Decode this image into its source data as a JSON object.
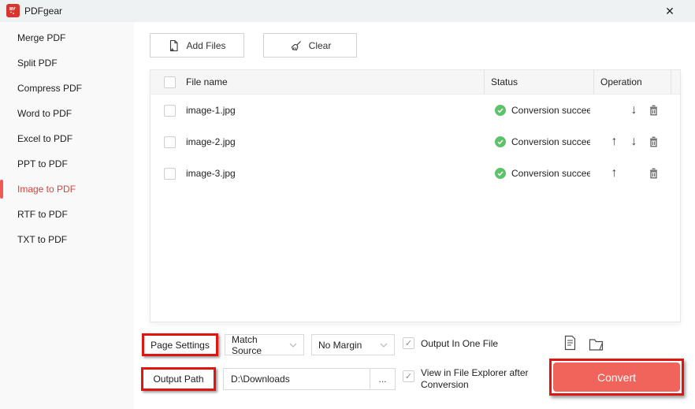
{
  "window": {
    "app_title": "PDFgear",
    "close_glyph": "✕"
  },
  "sidebar": {
    "items": [
      {
        "label": "Merge PDF"
      },
      {
        "label": "Split PDF"
      },
      {
        "label": "Compress PDF"
      },
      {
        "label": "Word to PDF"
      },
      {
        "label": "Excel to PDF"
      },
      {
        "label": "PPT to PDF"
      },
      {
        "label": "Image to PDF",
        "active": true
      },
      {
        "label": "RTF to PDF"
      },
      {
        "label": "TXT to PDF"
      }
    ]
  },
  "toolbar": {
    "add_files_label": "Add Files",
    "clear_label": "Clear"
  },
  "file_table": {
    "headers": {
      "file_name": "File name",
      "status": "Status",
      "operation": "Operation"
    },
    "rows": [
      {
        "file_name": "image-1.jpg",
        "status": "Conversion succeeded",
        "operations": [
          "move-down",
          "delete"
        ]
      },
      {
        "file_name": "image-2.jpg",
        "status": "Conversion succeeded",
        "operations": [
          "move-up",
          "move-down",
          "delete"
        ]
      },
      {
        "file_name": "image-3.jpg",
        "status": "Conversion succeeded",
        "operations": [
          "move-up",
          "delete"
        ]
      }
    ]
  },
  "page_settings": {
    "label": "Page Settings",
    "page_size_selected": "Match Source",
    "margin_selected": "No Margin",
    "output_in_one_file_label": "Output In One File",
    "output_in_one_file_checked": true
  },
  "output": {
    "label": "Output Path",
    "path_value": "D:\\Downloads",
    "browse_label": "...",
    "view_in_explorer_label": "View in File Explorer after Conversion",
    "view_in_explorer_checked": true,
    "convert_label": "Convert"
  },
  "colors": {
    "annotation_red": "#e11510",
    "convert_button": "#f1645b",
    "success_green": "#5ec269",
    "active_item_red": "#d5443c",
    "titlebar_bg": "#eff2f3"
  }
}
